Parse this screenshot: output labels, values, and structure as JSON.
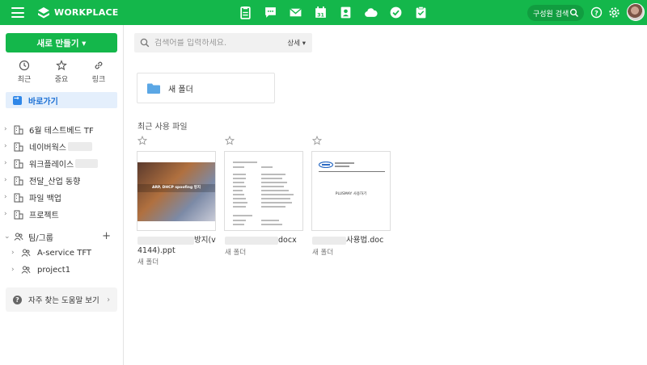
{
  "topbar": {
    "logo_text": "WORKPLACE",
    "apps": [
      "clipboard-icon",
      "chat-icon",
      "mail-icon",
      "calendar-icon",
      "contacts-icon",
      "cloud-icon",
      "check-icon",
      "board-icon"
    ],
    "search_label": "구성원 검색",
    "accent": "#14b74b"
  },
  "sidebar": {
    "new_button": "새로 만들기 ▾",
    "quick": [
      {
        "label": "최근",
        "icon": "clock-icon"
      },
      {
        "label": "중요",
        "icon": "star-icon"
      },
      {
        "label": "링크",
        "icon": "link-icon"
      }
    ],
    "shortcut": "바로가기",
    "items": [
      {
        "label": "6월 테스트베드 TF"
      },
      {
        "label": "네이버웍스"
      },
      {
        "label": "워크플레이스"
      },
      {
        "label": "전달_산업 동향"
      },
      {
        "label": "파일 백업"
      },
      {
        "label": "프로젝트"
      }
    ],
    "team_label": "팀/그룹",
    "plus": "+",
    "teams": [
      {
        "label": "A-service TFT"
      },
      {
        "label": "project1"
      }
    ],
    "help": "자주 찾는 도움말 보기"
  },
  "main": {
    "search_placeholder": "검색어를 입력하세요.",
    "detail": "상세 ▾",
    "folder_name": "새 폴더",
    "recent_title": "최근 사용 파일",
    "files": [
      {
        "name_tail": "방지(v",
        "name_line2": "4144).ppt",
        "location": "새 폴더",
        "thumb_title": "ARP, DHCP spoofing 방지"
      },
      {
        "name_tail": "docx",
        "location": "새 폴더"
      },
      {
        "name_tail": "사용법.doc",
        "location": "새 폴더",
        "thumb_title": "PLUSMAY 사용하기"
      }
    ]
  }
}
